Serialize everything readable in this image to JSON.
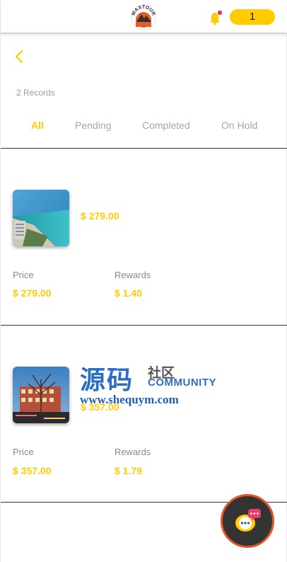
{
  "header": {
    "logo_text": "MAXTOUR",
    "badge_count": "1",
    "icons": [
      "bell-icon",
      "back-arrow-icon",
      "chat-icon"
    ]
  },
  "records_label": "2 Records",
  "tabs": [
    {
      "label": "All",
      "active": true
    },
    {
      "label": "Pending",
      "active": false
    },
    {
      "label": "Completed",
      "active": false
    },
    {
      "label": "On Hold",
      "active": false
    }
  ],
  "orders": [
    {
      "card_price": "$ 279.00",
      "price_label": "Price",
      "price_value": "$ 279.00",
      "rewards_label": "Rewards",
      "rewards_value": "$ 1.40"
    },
    {
      "card_price": "$ 357.00",
      "price_label": "Price",
      "price_value": "$ 357.00",
      "rewards_label": "Rewards",
      "rewards_value": "$ 1.79"
    }
  ],
  "watermark": {
    "big": "源码",
    "small": "社区",
    "community": "COMMUNITY",
    "url": "www.shequym.com"
  },
  "colors": {
    "accent": "#ffcc00",
    "muted": "#a5a5a5",
    "fab_bg": "#333333",
    "fab_border": "#e0552c"
  }
}
